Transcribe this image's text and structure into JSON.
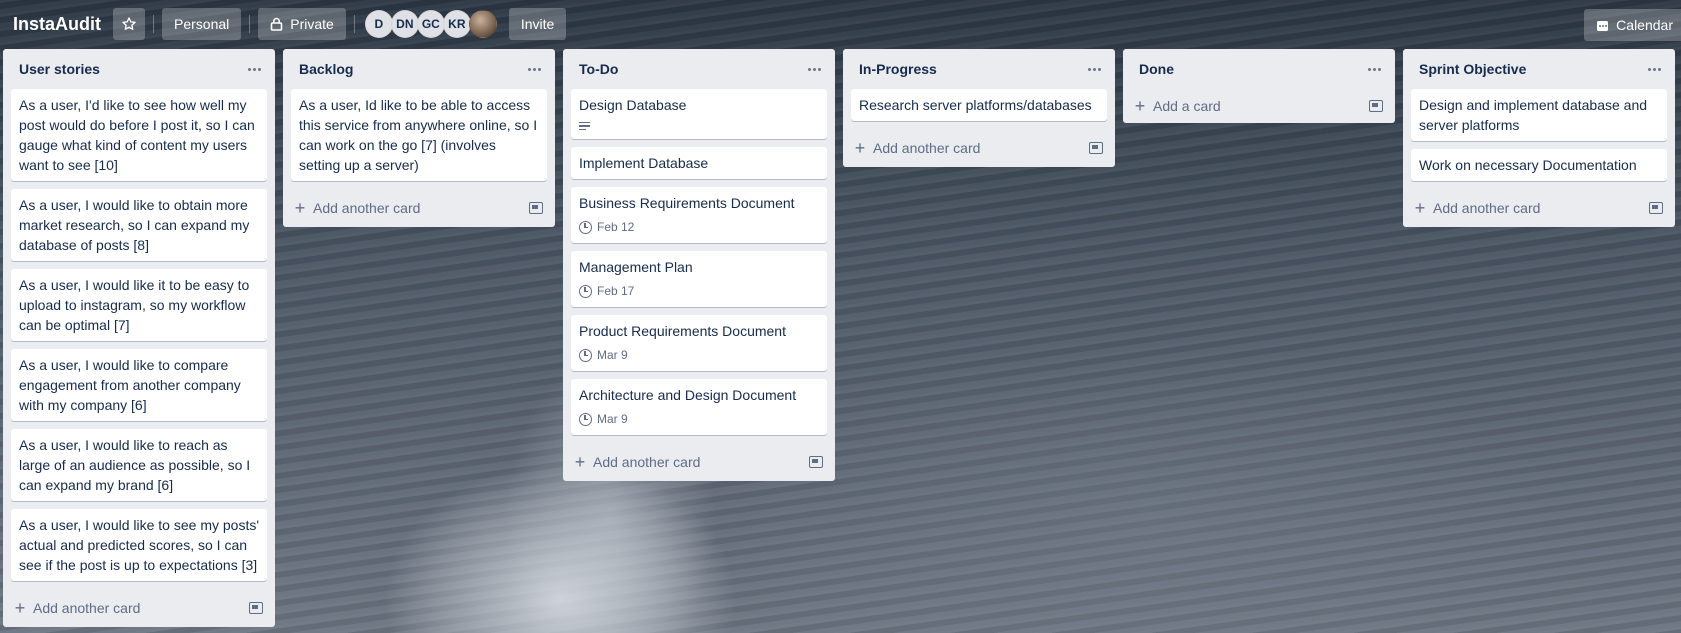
{
  "header": {
    "board_title": "InstaAudit",
    "personal_label": "Personal",
    "private_label": "Private",
    "invite_label": "Invite",
    "calendar_label": "Calendar",
    "members": [
      "D",
      "DN",
      "GC",
      "KR"
    ]
  },
  "lists": [
    {
      "title": "User stories",
      "cards": [
        {
          "text": "As a user, I'd like to see how well my post would do before I post it, so I can gauge what kind of content my users want to see [10]"
        },
        {
          "text": "As a user, I would like to obtain more market research, so I can expand my database of posts [8]"
        },
        {
          "text": "As a user, I would like it to be easy to upload to instagram, so my workflow can be optimal [7]"
        },
        {
          "text": "As a user, I would like to compare engagement from another company with my company [6]"
        },
        {
          "text": "As a user, I would like to reach as large of an audience as possible, so I can expand my brand [6]"
        },
        {
          "text": "As a user, I would like to see my posts' actual and predicted scores, so I can see if the post is up to expectations [3]"
        }
      ],
      "add_label": "Add another card"
    },
    {
      "title": "Backlog",
      "cards": [
        {
          "text": "As a user, Id like to be able to access this service from anywhere online, so I can work on the go [7] (involves setting up a server)"
        }
      ],
      "add_label": "Add another card"
    },
    {
      "title": "To-Do",
      "cards": [
        {
          "text": "Design Database",
          "has_description": true
        },
        {
          "text": "Implement Database"
        },
        {
          "text": "Business Requirements Document",
          "due": "Feb 12"
        },
        {
          "text": "Management Plan",
          "due": "Feb 17"
        },
        {
          "text": "Product Requirements Document",
          "due": "Mar 9"
        },
        {
          "text": "Architecture and Design Document",
          "due": "Mar 9"
        }
      ],
      "add_label": "Add another card"
    },
    {
      "title": "In-Progress",
      "cards": [
        {
          "text": "Research server platforms/databases"
        }
      ],
      "add_label": "Add another card"
    },
    {
      "title": "Done",
      "cards": [],
      "add_label": "Add a card"
    },
    {
      "title": "Sprint Objective",
      "cards": [
        {
          "text": "Design and implement database and server platforms"
        },
        {
          "text": "Work on necessary Documentation"
        }
      ],
      "add_label": "Add another card"
    }
  ]
}
